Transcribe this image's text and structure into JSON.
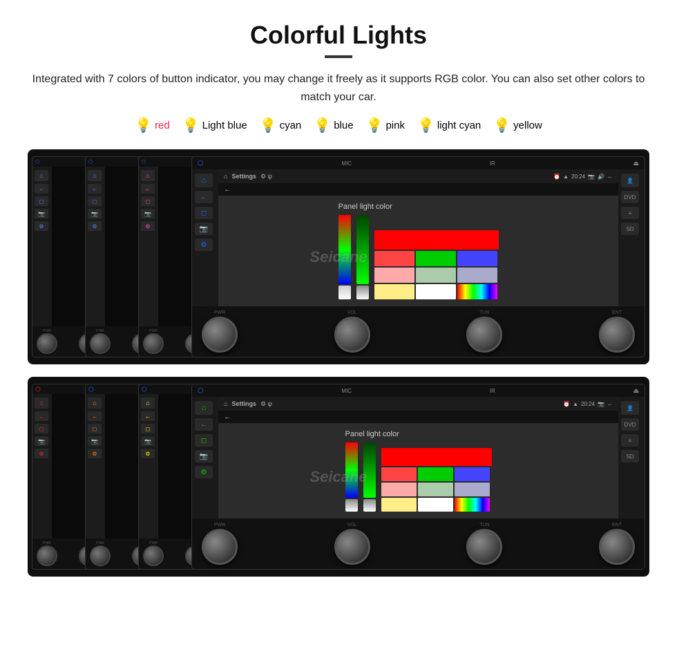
{
  "page": {
    "title": "Colorful Lights",
    "description": "Integrated with 7 colors of button indicator, you may change it freely as it supports RGB color. You can also set other colors to match your car.",
    "watermark": "Seicane"
  },
  "colors": [
    {
      "name": "red",
      "color": "#ff2244",
      "bulb": "🔴"
    },
    {
      "name": "Light blue",
      "color": "#66aaff",
      "bulb": "🔵"
    },
    {
      "name": "cyan",
      "color": "#00eeff",
      "bulb": "💡"
    },
    {
      "name": "blue",
      "color": "#3355ff",
      "bulb": "🔵"
    },
    {
      "name": "pink",
      "color": "#ff44cc",
      "bulb": "💗"
    },
    {
      "name": "light cyan",
      "color": "#aaffee",
      "bulb": "💡"
    },
    {
      "name": "yellow",
      "color": "#ffee00",
      "bulb": "💛"
    }
  ],
  "device_top": {
    "screen": {
      "settings_label": "Settings",
      "time": "20:24",
      "panel_color_label": "Panel light color"
    },
    "knob_labels": [
      "PWR",
      "VOL",
      "TUN",
      "ENT"
    ]
  },
  "device_bottom": {
    "screen": {
      "settings_label": "Settings",
      "time": "20:24",
      "panel_color_label": "Panel light color"
    },
    "knob_labels": [
      "PWR",
      "VOL",
      "TUN",
      "ENT"
    ]
  },
  "swatches_top": [
    "#ff0000",
    "#00ff00",
    "#0000ff",
    "#ff6666",
    "#66ff66",
    "#9999ff",
    "#ffaaaa",
    "#aaffaa",
    "#ccccff",
    "#ffee88",
    "#ffffff",
    "#aabbff"
  ],
  "swatches_bottom": [
    "#ff0000",
    "#00ff00",
    "#0000ff",
    "#ff6666",
    "#66ff66",
    "#9999ff",
    "#ffaaaa",
    "#aaffaa",
    "#ccccff",
    "#ffee88",
    "#ffffff",
    "#aabbff"
  ],
  "icons": {
    "bluetooth": "₿",
    "home": "⌂",
    "back": "←",
    "android": "A",
    "camera": "📷",
    "settings": "⚙",
    "dvd": "DVD",
    "eq": "≡",
    "sd": "SD"
  }
}
